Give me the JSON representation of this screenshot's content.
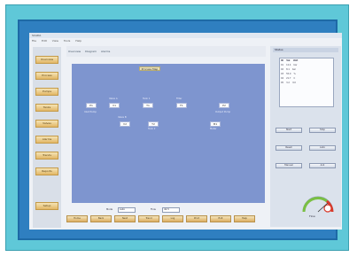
{
  "app": {
    "title": "SCADA",
    "menu": [
      "File",
      "Edit",
      "View",
      "Tools",
      "Help"
    ],
    "tabs": [
      "Overview",
      "Diagram",
      "Alarms"
    ],
    "canvas_title": "Process Map"
  },
  "sidebar": {
    "items": [
      {
        "label": "Overview"
      },
      {
        "label": "Process"
      },
      {
        "label": "Pumps"
      },
      {
        "label": "Tanks"
      },
      {
        "label": "Valves"
      },
      {
        "label": "Alarms"
      },
      {
        "label": "Trends"
      },
      {
        "label": "Reports"
      },
      {
        "label": "Setup"
      }
    ]
  },
  "nodes": [
    {
      "id": "n1",
      "label": "P1",
      "caption": "Inlet Pump"
    },
    {
      "id": "n2",
      "label": "V1",
      "caption": "Valve A"
    },
    {
      "id": "n3",
      "label": "T1",
      "caption": "Tank 1"
    },
    {
      "id": "n4",
      "label": "F1",
      "caption": "Filter"
    },
    {
      "id": "n5",
      "label": "P2",
      "caption": "Output Pump"
    },
    {
      "id": "n6",
      "label": "V2",
      "caption": "Valve B"
    },
    {
      "id": "n7",
      "label": "T2",
      "caption": "Tank 2"
    },
    {
      "id": "n8",
      "label": "M1",
      "caption": "Meter"
    }
  ],
  "right_panel": {
    "header": "Status",
    "table_headers": [
      "ID",
      "Val",
      "Unit"
    ],
    "rows": [
      [
        "01",
        "12.4",
        "bar"
      ],
      [
        "02",
        "8.1",
        "bar"
      ],
      [
        "03",
        "55.0",
        "%"
      ],
      [
        "04",
        "21.7",
        "C"
      ],
      [
        "05",
        "3.2",
        "m3"
      ]
    ],
    "buttons": [
      "Start",
      "Stop",
      "Reset",
      "Auto",
      "Manual",
      "Ack"
    ]
  },
  "bottom": {
    "fields": [
      {
        "label": "Mode",
        "value": "Auto"
      },
      {
        "label": "Flow",
        "value": "42.5"
      }
    ],
    "buttons": [
      "Home",
      "Back",
      "Next",
      "Trend",
      "Log",
      "Print",
      "Exit",
      "Help"
    ]
  },
  "gauge": {
    "value": 0.72,
    "label": "Flow"
  },
  "colors": {
    "frame": "#5fc8d8",
    "inner_border": "#2f7fc0",
    "canvas": "#7e95cf",
    "button_gold": "#e2b766",
    "alarm": "#d93a2b"
  }
}
